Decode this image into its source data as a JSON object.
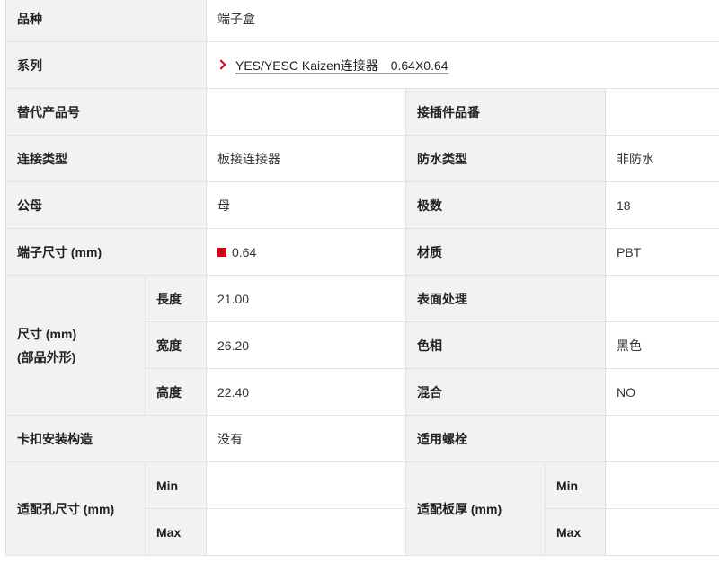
{
  "spec": {
    "variety_label": "品种",
    "variety_value": "端子盒",
    "series_label": "系列",
    "series_value": "YES/YESC Kaizen连接器　0.64X0.64",
    "alt_part_label": "替代产品号",
    "alt_part_value": "",
    "mating_label": "接插件品番",
    "mating_value": "",
    "conn_type_label": "连接类型",
    "conn_type_value": "板接连接器",
    "waterproof_label": "防水类型",
    "waterproof_value": "非防水",
    "gender_label": "公母",
    "gender_value": "母",
    "poles_label": "极数",
    "poles_value": "18",
    "terminal_size_label": "端子尺寸 (mm)",
    "terminal_size_value": "0.64",
    "terminal_size_color": "#d7001b",
    "material_label": "材质",
    "material_value": "PBT",
    "dims_label_line1": "尺寸 (mm)",
    "dims_label_line2": "(部品外形)",
    "length_label": "長度",
    "length_value": "21.00",
    "width_label": "宽度",
    "width_value": "26.20",
    "height_label": "高度",
    "height_value": "22.40",
    "surface_label": "表面处理",
    "surface_value": "",
    "color_label": "色相",
    "color_value": "黑色",
    "mixed_label": "混合",
    "mixed_value": "NO",
    "snap_label": "卡扣安装构造",
    "snap_value": "没有",
    "screw_label": "适用螺栓",
    "screw_value": "",
    "hole_label": "适配孔尺寸 (mm)",
    "hole_min_label": "Min",
    "hole_min_value": "",
    "hole_max_label": "Max",
    "hole_max_value": "",
    "board_label": "适配板厚 (mm)",
    "board_min_label": "Min",
    "board_min_value": "",
    "board_max_label": "Max",
    "board_max_value": ""
  }
}
